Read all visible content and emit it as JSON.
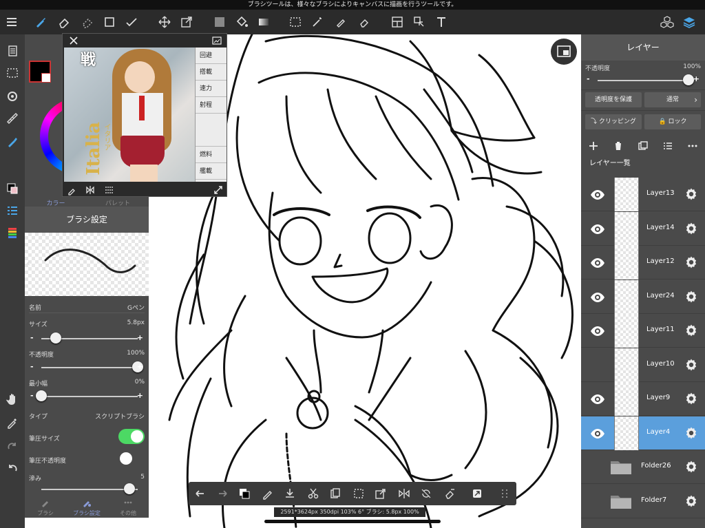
{
  "hint": "ブラシツールは、様々なブラシによりキャンバスに描画を行うツールです。",
  "colors": {
    "accent": "#5b9fdc",
    "toggle_on": "#4cd964",
    "panel": "#4a4a4a",
    "toolbar": "#2b2b2b"
  },
  "color_panel": {
    "tab_color": "カラー",
    "tab_palette": "パレット"
  },
  "reference": {
    "kanji_top": "戦",
    "title": "Italia",
    "kana": "イタリア",
    "stats": [
      "回避",
      "搭載",
      "速力",
      "射程",
      "",
      "燃料",
      "艦載",
      "3"
    ]
  },
  "brush": {
    "header": "ブラシ設定",
    "name_label": "名前",
    "name_value": "Gペン",
    "size_label": "サイズ",
    "size_value": "5.8px",
    "size_level": 0.15,
    "opacity_label": "不透明度",
    "opacity_value": "100%",
    "opacity_level": 1.0,
    "min_width_label": "最小幅",
    "min_width_value": "0%",
    "min_width_level": 0.0,
    "type_label": "タイプ",
    "type_value": "スクリプトブラシ",
    "pressure_size_label": "筆圧サイズ",
    "pressure_size_on": true,
    "pressure_opacity_label": "筆圧不透明度",
    "pressure_opacity_on": false,
    "blur_label": "滲み",
    "blur_value": "5",
    "minus": "-",
    "plus": "+",
    "tabs": [
      "ブラシ",
      "ブラシ設定",
      "その他"
    ]
  },
  "canvas_info": "2591*3624px 350dpi 103% 6° ブラシ: 5.8px 100%",
  "layers": {
    "header": "レイヤー",
    "opacity_label": "不透明度",
    "opacity_value": "100%",
    "opacity_level": 1.0,
    "protect_alpha": "透明度を保護",
    "blend_mode": "通常",
    "clipping": "クリッピング",
    "lock": "ロック",
    "list_title": "レイヤー一覧",
    "items": [
      {
        "name": "Layer13",
        "visible": true,
        "selected": false
      },
      {
        "name": "Layer14",
        "visible": true,
        "selected": false
      },
      {
        "name": "Layer12",
        "visible": true,
        "selected": false
      },
      {
        "name": "Layer24",
        "visible": true,
        "selected": false
      },
      {
        "name": "Layer11",
        "visible": true,
        "selected": false
      },
      {
        "name": "Layer10",
        "visible": false,
        "selected": false
      },
      {
        "name": "Layer9",
        "visible": true,
        "selected": false
      },
      {
        "name": "Layer4",
        "visible": true,
        "selected": true
      }
    ],
    "folders": [
      "Folder26",
      "Folder7"
    ]
  }
}
